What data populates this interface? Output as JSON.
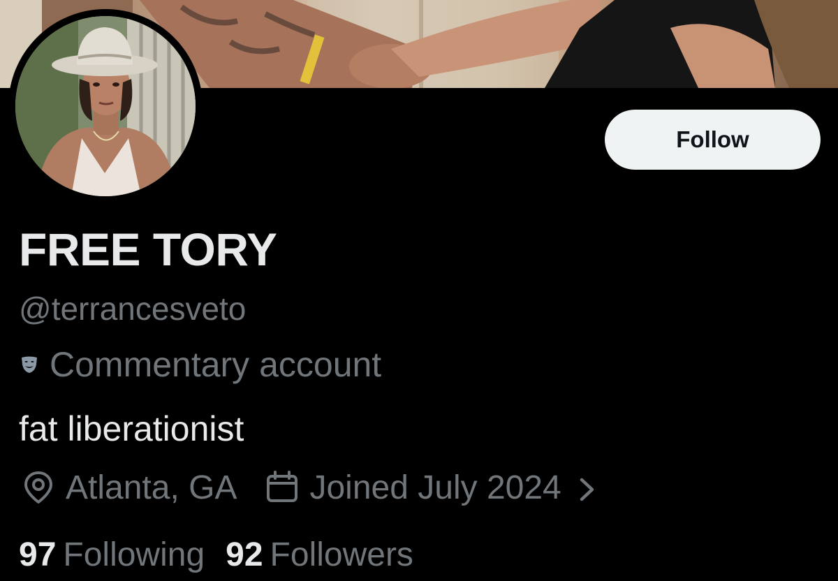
{
  "profile": {
    "display_name": "FREE TORY",
    "handle": "@terrancesveto",
    "label": "Commentary account",
    "bio": "fat liberationist",
    "location": "Atlanta, GA",
    "joined": "Joined July 2024"
  },
  "actions": {
    "follow_label": "Follow"
  },
  "stats": {
    "following_count": "97",
    "following_label": "Following",
    "followers_count": "92",
    "followers_label": "Followers"
  },
  "icons": {
    "label": "mask-icon",
    "location": "location-pin-icon",
    "joined": "calendar-icon",
    "joined_more": "chevron-right-icon"
  },
  "colors": {
    "background": "#000000",
    "primary_text": "#e7e9ea",
    "secondary_text": "#71767b",
    "follow_button_bg": "#eff3f4",
    "follow_button_text": "#0f1419"
  }
}
